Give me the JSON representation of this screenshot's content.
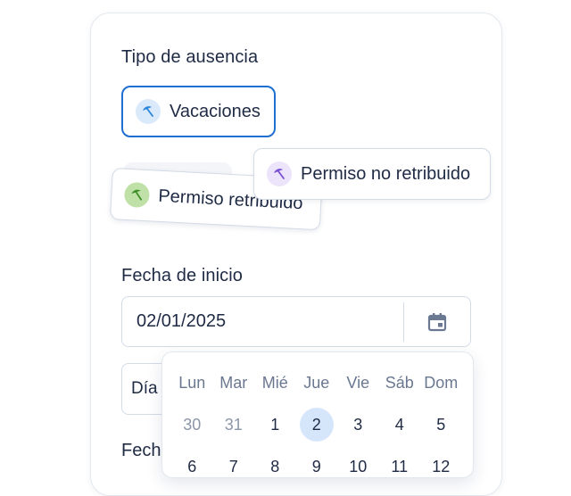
{
  "form": {
    "absence_type_label": "Tipo de ausencia",
    "start_date_label": "Fecha de inicio",
    "end_date_label_partial": "Fech",
    "start_date_value": "02/01/2025",
    "day_field_partial": "Día"
  },
  "options": {
    "vacaciones": "Vacaciones",
    "permiso_retribuido": "Permiso retribuido",
    "permiso_no_retribuido": "Permiso no retribuido"
  },
  "calendar": {
    "weekdays": [
      "Lun",
      "Mar",
      "Mié",
      "Jue",
      "Vie",
      "Sáb",
      "Dom"
    ],
    "week1": [
      "30",
      "31",
      "1",
      "2",
      "3",
      "4",
      "5"
    ],
    "week2": [
      "6",
      "7",
      "8",
      "9",
      "10",
      "11",
      "12"
    ],
    "selected_day": "2"
  },
  "colors": {
    "accent": "#1f6fd1",
    "vacaciones_icon_bg": "#dbeafb",
    "vacaciones_icon": "#2b86d9",
    "retribuido_icon_bg": "#bfe0a6",
    "retribuido_icon": "#3f8f2a",
    "no_retribuido_icon_bg": "#ece4fb",
    "no_retribuido_icon": "#7a4fd1"
  },
  "icons": {
    "option_icon": "beach-umbrella-icon",
    "date_picker": "calendar-icon"
  }
}
